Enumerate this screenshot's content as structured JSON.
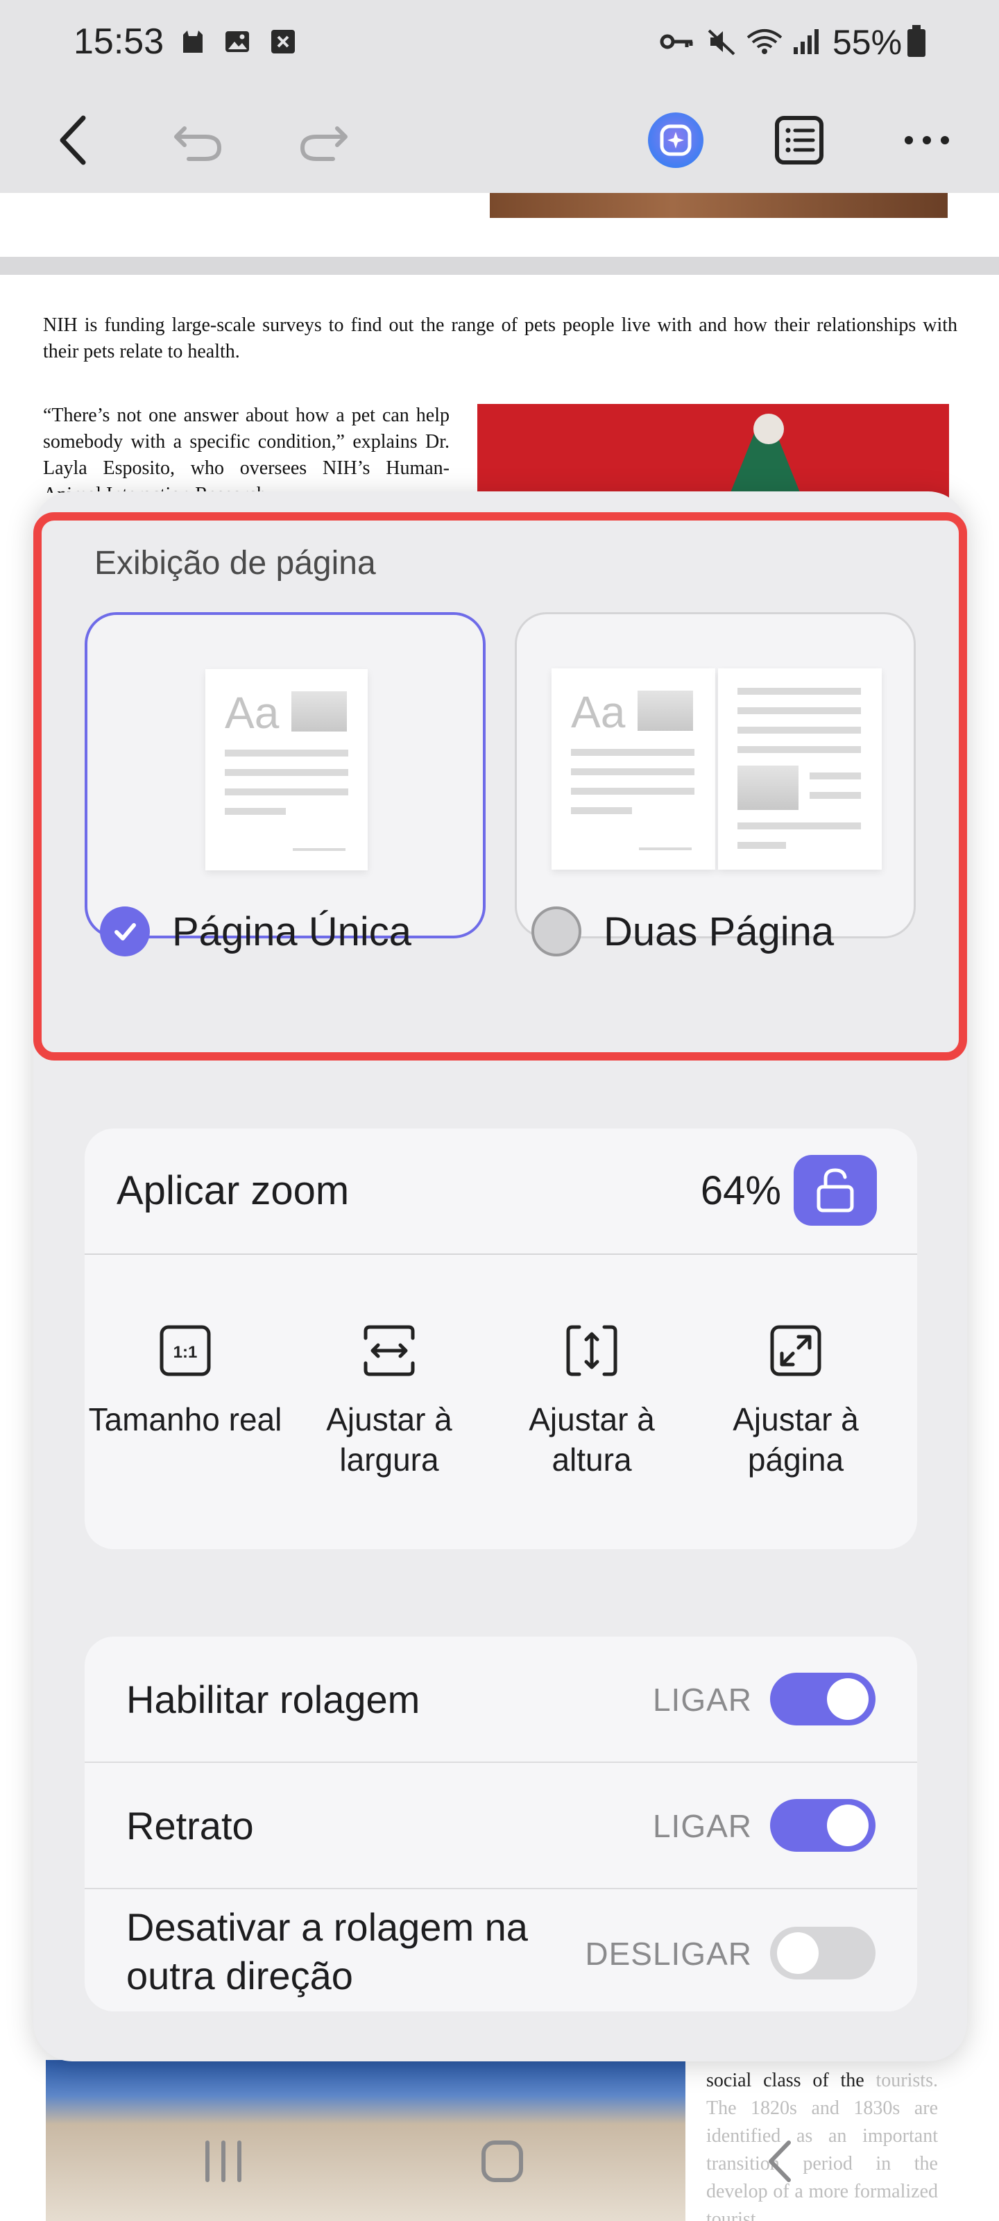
{
  "status_bar": {
    "time": "15:53",
    "battery": "55%"
  },
  "document": {
    "paragraph1": "NIH is funding large-scale surveys to find out the range of pets people live with and how their relationships with their pets relate to health.",
    "paragraph2": "“There’s not one answer about how a pet can help somebody with a specific condition,” explains Dr. Layla Esposito, who oversees NIH’s Human-Animal Interaction Research",
    "bottom_text_visible": "social class of the",
    "bottom_text_faded": "tourists. The 1820s and 1830s are identified as an important transition period in the develop of a more formalized tourist"
  },
  "page_view": {
    "title": "Exibição de página",
    "options": [
      {
        "label": "Página Única",
        "selected": true
      },
      {
        "label": "Duas Página",
        "selected": false
      }
    ],
    "thumb_text": "Aa"
  },
  "zoom": {
    "title": "Aplicar zoom",
    "value": "64%",
    "options": [
      {
        "label": "Tamanho real",
        "icon": "actual-size-icon",
        "icon_text": "1:1"
      },
      {
        "label": "Ajustar à largura",
        "icon": "fit-width-icon"
      },
      {
        "label": "Ajustar à altura",
        "icon": "fit-height-icon"
      },
      {
        "label": "Ajustar à página",
        "icon": "fit-page-icon"
      }
    ]
  },
  "settings": [
    {
      "label": "Habilitar rolagem",
      "state": "LIGAR",
      "on": true
    },
    {
      "label": "Retrato",
      "state": "LIGAR",
      "on": true
    },
    {
      "label": "Desativar a rolagem na outra direção",
      "state": "DESLIGAR",
      "on": false
    }
  ],
  "colors": {
    "accent": "#6e6be8",
    "highlight": "#ee4442"
  }
}
